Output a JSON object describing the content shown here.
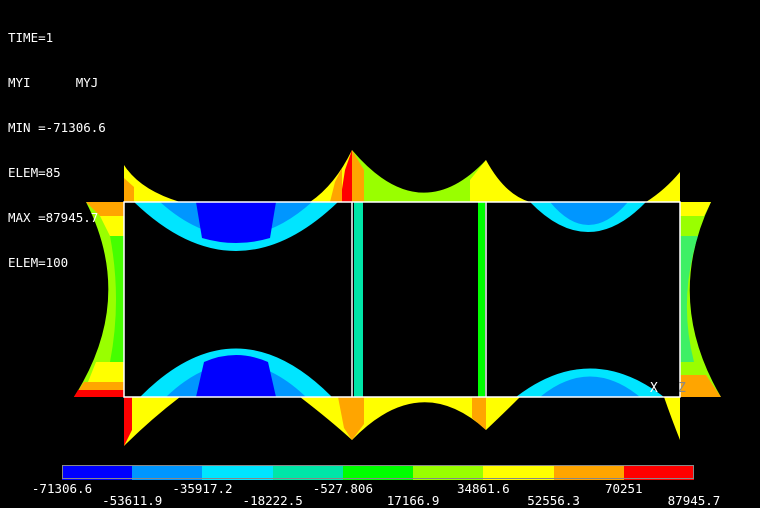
{
  "header": {
    "time": "TIME=1",
    "labels": "MYI      MYJ",
    "min": "MIN =-71306.6",
    "min_elem": "ELEM=85",
    "max": "MAX =87945.7",
    "max_elem": "ELEM=100"
  },
  "triad": {
    "x_label": "X",
    "z_label": "Z"
  },
  "legend": {
    "colors": [
      "#0000ff",
      "#0096ff",
      "#00e5ff",
      "#00e6a8",
      "#00ff00",
      "#99ff00",
      "#ffff00",
      "#ffa500",
      "#ff0000"
    ],
    "values": [
      "-71306.6",
      "-53611.9",
      "-35917.2",
      "-18222.5",
      "-527.806",
      "17166.9",
      "34861.6",
      "52556.3",
      "70251",
      "87945.7"
    ]
  }
}
